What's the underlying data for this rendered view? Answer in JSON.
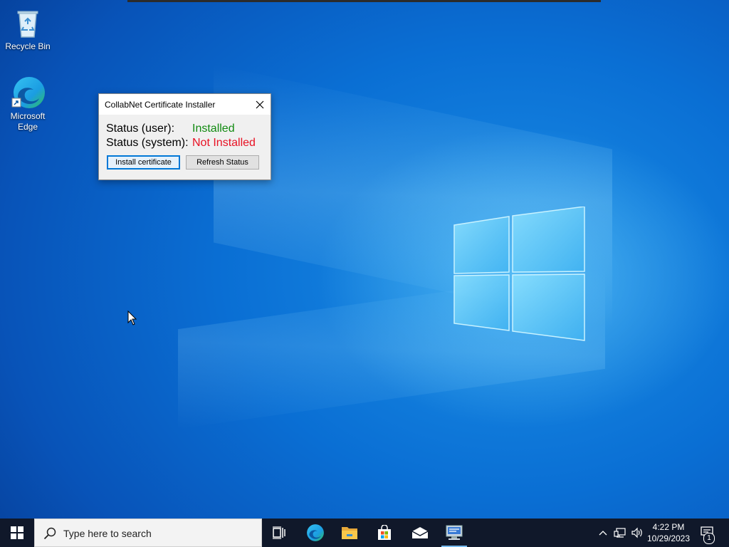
{
  "desktop": {
    "icons": [
      {
        "label": "Recycle Bin",
        "icon": "recycle-bin-icon"
      },
      {
        "label": "Microsoft Edge",
        "icon": "edge-icon"
      }
    ]
  },
  "dialog": {
    "title": "CollabNet Certificate Installer",
    "status_user_label": "Status (user):",
    "status_user_value": "Installed",
    "status_system_label": "Status (system):",
    "status_system_value": "Not Installed",
    "install_button": "Install certificate",
    "refresh_button": "Refresh Status",
    "colors": {
      "installed": "#108a10",
      "not_installed": "#e81123"
    }
  },
  "taskbar": {
    "search_placeholder": "Type here to search",
    "apps": [
      "task-view-icon",
      "edge-icon",
      "file-explorer-icon",
      "microsoft-store-icon",
      "mail-icon",
      "certificate-installer-icon"
    ],
    "time": "4:22 PM",
    "date": "10/29/2023",
    "notification_count": "1"
  }
}
